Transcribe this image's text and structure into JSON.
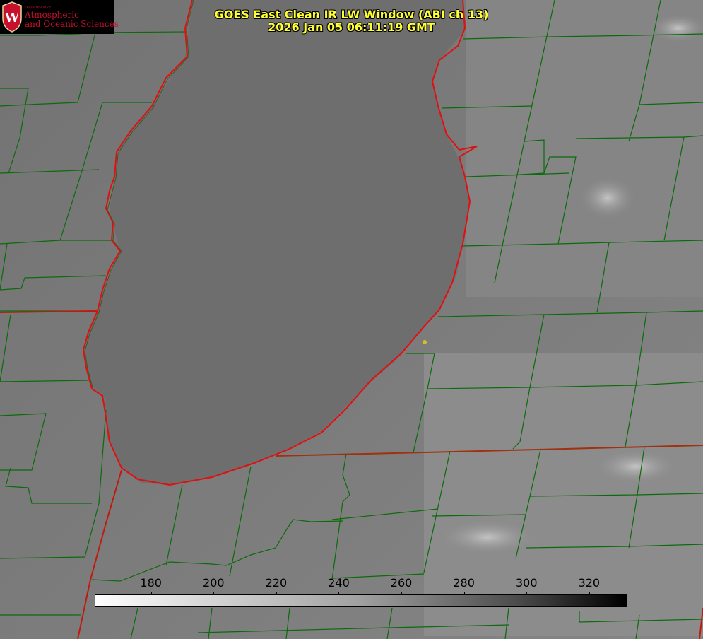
{
  "logo": {
    "department": "Department of",
    "line1": "Atmospheric",
    "line2": "and Oceanic Sciences",
    "crest_letter": "W"
  },
  "title": {
    "line1": "GOES East Clean IR LW Window (ABI ch 13)",
    "line2": "2026 Jan 05 06:11:19 GMT"
  },
  "colorbar": {
    "ticks": [
      "180",
      "200",
      "220",
      "240",
      "260",
      "280",
      "300",
      "320"
    ],
    "tick_values": [
      180,
      200,
      220,
      240,
      260,
      280,
      300,
      320
    ],
    "range": [
      162,
      332
    ],
    "gradient": "white-to-black"
  },
  "colors": {
    "county_lines": "#0b6b0b",
    "state_and_lake_outline": "#e01010",
    "title_text": "#ffff33",
    "brand": "#c8102e",
    "station_dot": "#d4c21a"
  },
  "icons": {
    "crest": "uw-crest-icon",
    "station": "station-marker-icon"
  }
}
